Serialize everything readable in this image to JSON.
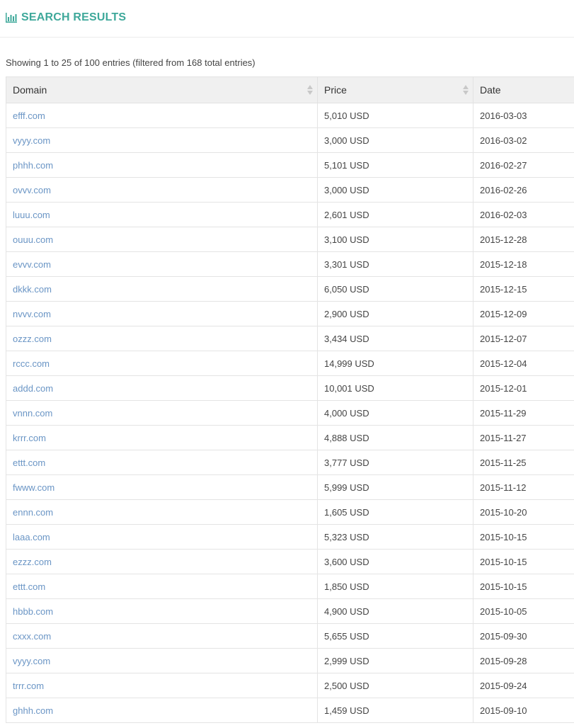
{
  "header": {
    "title": "SEARCH RESULTS",
    "icon": "bar-chart-icon",
    "color": "#3ea89a"
  },
  "info": "Showing 1 to 25 of 100 entries (filtered from 168 total entries)",
  "table": {
    "columns": [
      "Domain",
      "Price",
      "Date"
    ],
    "rows": [
      {
        "domain": "efff.com",
        "price": "5,010 USD",
        "date": "2016-03-03"
      },
      {
        "domain": "vyyy.com",
        "price": "3,000 USD",
        "date": "2016-03-02"
      },
      {
        "domain": "phhh.com",
        "price": "5,101 USD",
        "date": "2016-02-27"
      },
      {
        "domain": "ovvv.com",
        "price": "3,000 USD",
        "date": "2016-02-26"
      },
      {
        "domain": "luuu.com",
        "price": "2,601 USD",
        "date": "2016-02-03"
      },
      {
        "domain": "ouuu.com",
        "price": "3,100 USD",
        "date": "2015-12-28"
      },
      {
        "domain": "evvv.com",
        "price": "3,301 USD",
        "date": "2015-12-18"
      },
      {
        "domain": "dkkk.com",
        "price": "6,050 USD",
        "date": "2015-12-15"
      },
      {
        "domain": "nvvv.com",
        "price": "2,900 USD",
        "date": "2015-12-09"
      },
      {
        "domain": "ozzz.com",
        "price": "3,434 USD",
        "date": "2015-12-07"
      },
      {
        "domain": "rccc.com",
        "price": "14,999 USD",
        "date": "2015-12-04"
      },
      {
        "domain": "addd.com",
        "price": "10,001 USD",
        "date": "2015-12-01"
      },
      {
        "domain": "vnnn.com",
        "price": "4,000 USD",
        "date": "2015-11-29"
      },
      {
        "domain": "krrr.com",
        "price": "4,888 USD",
        "date": "2015-11-27"
      },
      {
        "domain": "ettt.com",
        "price": "3,777 USD",
        "date": "2015-11-25"
      },
      {
        "domain": "fwww.com",
        "price": "5,999 USD",
        "date": "2015-11-12"
      },
      {
        "domain": "ennn.com",
        "price": "1,605 USD",
        "date": "2015-10-20"
      },
      {
        "domain": "laaa.com",
        "price": "5,323 USD",
        "date": "2015-10-15"
      },
      {
        "domain": "ezzz.com",
        "price": "3,600 USD",
        "date": "2015-10-15"
      },
      {
        "domain": "ettt.com",
        "price": "1,850 USD",
        "date": "2015-10-15"
      },
      {
        "domain": "hbbb.com",
        "price": "4,900 USD",
        "date": "2015-10-05"
      },
      {
        "domain": "cxxx.com",
        "price": "5,655 USD",
        "date": "2015-09-30"
      },
      {
        "domain": "vyyy.com",
        "price": "2,999 USD",
        "date": "2015-09-28"
      },
      {
        "domain": "trrr.com",
        "price": "2,500 USD",
        "date": "2015-09-24"
      },
      {
        "domain": "ghhh.com",
        "price": "1,459 USD",
        "date": "2015-09-10"
      }
    ]
  }
}
